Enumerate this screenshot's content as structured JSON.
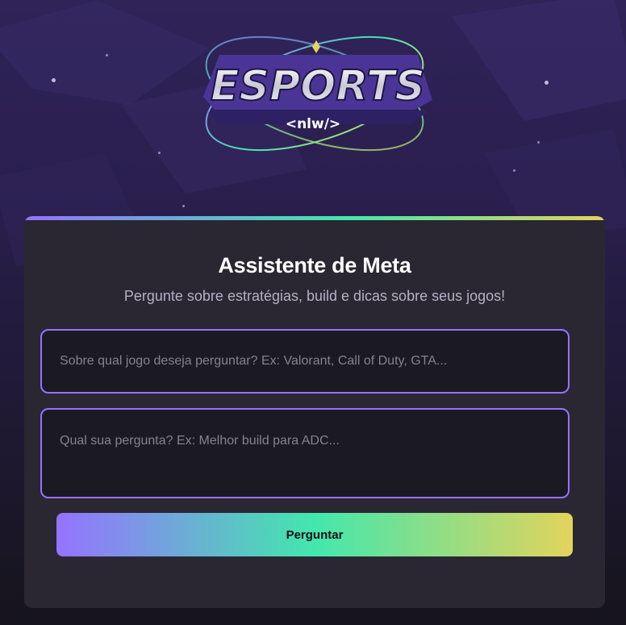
{
  "logo": {
    "wordmark": "ESPORTS",
    "tag": "<nlw/>"
  },
  "card": {
    "title": "Assistente de Meta",
    "subtitle": "Pergunte sobre estratégias, build e dicas sobre seus jogos!"
  },
  "form": {
    "game_placeholder": "Sobre qual jogo deseja perguntar? Ex: Valorant, Call of Duty, GTA...",
    "game_value": "",
    "question_placeholder": "Qual sua pergunta? Ex: Melhor build para ADC...",
    "question_value": "",
    "submit_label": "Perguntar"
  },
  "colors": {
    "accent_purple": "#9572ff",
    "accent_green": "#43e7ad",
    "accent_yellow": "#e2d45c",
    "card_bg": "#2a2733",
    "input_bg": "#1b1a22"
  }
}
